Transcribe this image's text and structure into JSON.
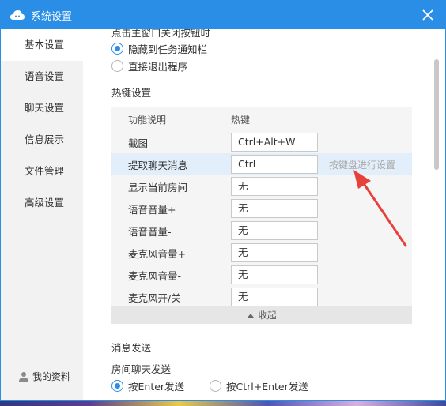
{
  "window": {
    "title": "系统设置"
  },
  "sidebar": {
    "items": [
      {
        "label": "基本设置"
      },
      {
        "label": "语音设置"
      },
      {
        "label": "聊天设置"
      },
      {
        "label": "信息展示"
      },
      {
        "label": "文件管理"
      },
      {
        "label": "高级设置"
      }
    ],
    "active_index": 0,
    "profile_label": "我的资料"
  },
  "main": {
    "cut_heading": "点击主窗口关闭按钮时",
    "close_options": [
      {
        "label": "隐藏到任务通知栏",
        "selected": true
      },
      {
        "label": "直接退出程序",
        "selected": false
      }
    ],
    "hotkeys": {
      "title": "热键设置",
      "col_function": "功能说明",
      "col_hotkey": "热键",
      "rows": [
        {
          "label": "截图",
          "value": "Ctrl+Alt+W"
        },
        {
          "label": "提取聊天消息",
          "value": "Ctrl"
        },
        {
          "label": "显示当前房间",
          "value": "无"
        },
        {
          "label": "语音音量+",
          "value": "无"
        },
        {
          "label": "语音音量-",
          "value": "无"
        },
        {
          "label": "麦克风音量+",
          "value": "无"
        },
        {
          "label": "麦克风音量-",
          "value": "无"
        },
        {
          "label": "麦克风开/关",
          "value": "无"
        }
      ],
      "active_row": 1,
      "hint": "按键盘进行设置",
      "collapse_label": "收起"
    },
    "message_send": {
      "title": "消息发送",
      "subtitle": "房间聊天发送",
      "options": [
        {
          "label": "按Enter发送",
          "selected": true
        },
        {
          "label": "按Ctrl+Enter发送",
          "selected": false
        }
      ]
    }
  },
  "colors": {
    "accent": "#2b8ee6",
    "annotation": "#e8403a"
  }
}
